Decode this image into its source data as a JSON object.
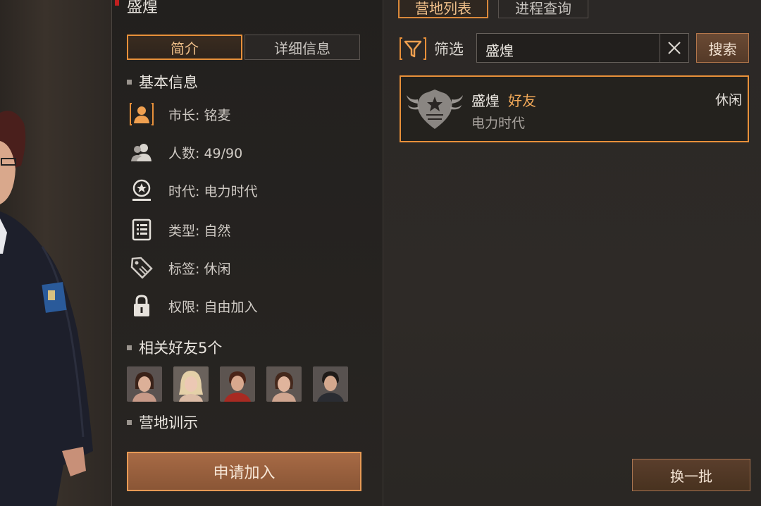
{
  "panel_title": "盛煌",
  "left_tabs": {
    "intro": "简介",
    "detail": "详细信息"
  },
  "sections": {
    "basic_info": "基本信息",
    "related_friends": "相关好友5个",
    "camp_motto": "营地训示"
  },
  "info": {
    "mayor": "市长: 铭麦",
    "members": "人数: 49/90",
    "era": "时代: 电力时代",
    "type": "类型: 自然",
    "tag": "标签: 休闲",
    "permission": "权限: 自由加入"
  },
  "friends": [
    {
      "icon": "avatar-female-brunette"
    },
    {
      "icon": "avatar-female-blonde"
    },
    {
      "icon": "avatar-male-red-shirt"
    },
    {
      "icon": "avatar-female-brunette-2"
    },
    {
      "icon": "avatar-male-dark"
    }
  ],
  "apply_button": "申请加入",
  "right_tabs": {
    "camp_list": "营地列表",
    "progress_query": "进程查询"
  },
  "filter_label": "筛选",
  "search": {
    "value": "盛煌",
    "button": "搜索"
  },
  "camp_result": {
    "name": "盛煌",
    "friend_badge": "好友",
    "era": "电力时代",
    "tag": "休闲"
  },
  "refresh_button": "换一批",
  "colors": {
    "accent": "#e8903a",
    "friend_text": "#f0a858",
    "panel_bg": "#2a2624"
  }
}
